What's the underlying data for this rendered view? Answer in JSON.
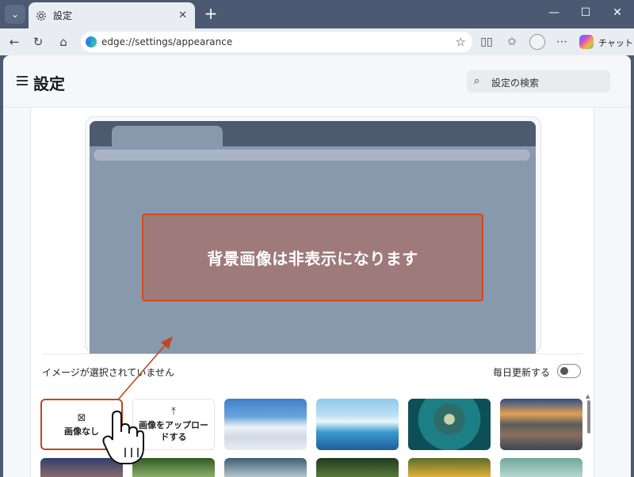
{
  "tab": {
    "title": "設定",
    "close": "✕"
  },
  "window": {
    "minimize": "—",
    "maximize": "☐",
    "close": "✕"
  },
  "address": {
    "url": "edge://settings/appearance"
  },
  "toolbar": {
    "chat_label": "チャット"
  },
  "header": {
    "title": "設定",
    "search_placeholder": "設定の検索"
  },
  "preview": {
    "hidden_message": "背景画像は非表示になります"
  },
  "background": {
    "status": "イメージが選択されていません",
    "daily_update_label": "毎日更新する",
    "daily_update_on": false,
    "no_image_label": "画像なし",
    "upload_label_line1": "画像をアップロー",
    "upload_label_line2": "ドする",
    "selected_option": "画像なし"
  },
  "colors": {
    "accent": "#c0471d",
    "chrome": "#4b5a72",
    "preview_bg": "#8898ad",
    "overlay_box": "#9f7a7b"
  }
}
